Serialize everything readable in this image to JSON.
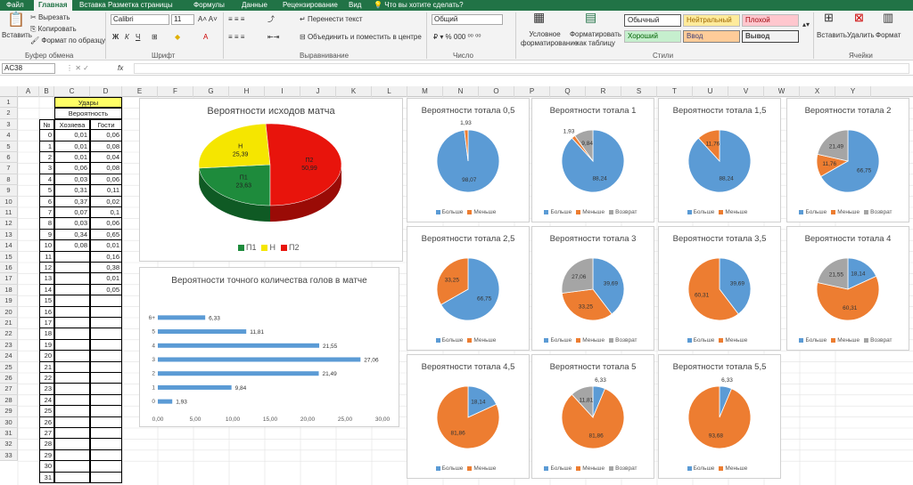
{
  "tabs": [
    "Файл",
    "Главная",
    "Вставка",
    "Разметка страницы",
    "Формулы",
    "Данные",
    "Рецензирование",
    "Вид",
    "Что вы хотите сделать?"
  ],
  "ribbon": {
    "paste": "Вставить",
    "cut": "Вырезать",
    "copy": "Копировать",
    "format_painter": "Формат по образцу",
    "clipboard": "Буфер обмена",
    "font_name": "Calibri",
    "font_size": "11",
    "font": "Шрифт",
    "wrap_text": "Перенести текст",
    "merge": "Объединить и поместить в центре",
    "alignment": "Выравнивание",
    "number_format": "Общий",
    "number": "Число",
    "cond_format": "Условное форматирование",
    "format_table": "Форматировать как таблицу",
    "styles_label": "Стили",
    "style_normal": "Обычный",
    "style_neutral": "Нейтральный",
    "style_bad": "Плохой",
    "style_good": "Хороший",
    "style_input": "Ввод",
    "style_output": "Вывод",
    "insert": "Вставить",
    "delete": "Удалить",
    "format": "Формат",
    "cells": "Ячейки"
  },
  "formula_bar": {
    "name_box": "AC38",
    "fx": "fx",
    "value": ""
  },
  "columns": [
    "A",
    "B",
    "C",
    "D",
    "E",
    "F",
    "G",
    "H",
    "I",
    "J",
    "K",
    "L",
    "M",
    "N",
    "O",
    "P",
    "Q",
    "R",
    "S",
    "T",
    "U",
    "V",
    "W",
    "X",
    "Y"
  ],
  "rows": [
    "1",
    "2",
    "3",
    "4",
    "5",
    "6",
    "7",
    "8",
    "9",
    "10",
    "11",
    "12",
    "13",
    "14",
    "15",
    "16",
    "17",
    "18",
    "19",
    "20",
    "21",
    "22",
    "23",
    "24",
    "25",
    "26",
    "27",
    "28",
    "29",
    "30",
    "31",
    "32",
    "33"
  ],
  "table": {
    "header1": "Удары",
    "header2": "Вероятность",
    "col_no": "№",
    "col_home": "Хозяева",
    "col_away": "Гости",
    "rows": [
      [
        "0",
        "0,01",
        "0,06"
      ],
      [
        "1",
        "0,01",
        "0,08"
      ],
      [
        "2",
        "0,01",
        "0,04"
      ],
      [
        "3",
        "0,06",
        "0,08"
      ],
      [
        "4",
        "0,03",
        "0,06"
      ],
      [
        "5",
        "0,31",
        "0,11"
      ],
      [
        "6",
        "0,37",
        "0,02"
      ],
      [
        "7",
        "0,07",
        "0,1"
      ],
      [
        "8",
        "0,03",
        "0,06"
      ],
      [
        "9",
        "0,34",
        "0,65"
      ],
      [
        "10",
        "0,08",
        "0,01"
      ],
      [
        "11",
        "",
        "0,16"
      ],
      [
        "12",
        "",
        "0,38"
      ],
      [
        "13",
        "",
        "0,01"
      ],
      [
        "14",
        "",
        "0,05"
      ],
      [
        "15",
        "",
        ""
      ],
      [
        "16",
        "",
        ""
      ],
      [
        "17",
        "",
        ""
      ],
      [
        "18",
        "",
        ""
      ],
      [
        "19",
        "",
        ""
      ],
      [
        "20",
        "",
        ""
      ],
      [
        "21",
        "",
        ""
      ],
      [
        "22",
        "",
        ""
      ],
      [
        "23",
        "",
        ""
      ],
      [
        "24",
        "",
        ""
      ],
      [
        "25",
        "",
        ""
      ],
      [
        "26",
        "",
        ""
      ],
      [
        "27",
        "",
        ""
      ],
      [
        "28",
        "",
        ""
      ],
      [
        "29",
        "",
        ""
      ],
      [
        "30",
        "",
        ""
      ],
      [
        "31",
        "",
        ""
      ]
    ]
  },
  "colors": {
    "green": "#1e8b3c",
    "yellow": "#f5e600",
    "red": "#e8140c",
    "blue": "#5b9bd5",
    "orange": "#ed7d31",
    "gray": "#a5a5a5",
    "excel": "#217346"
  },
  "chart_data": [
    {
      "type": "pie",
      "title": "Вероятности исходов матча",
      "labels": [
        "П1",
        "Н",
        "П2"
      ],
      "values": [
        23.63,
        25.39,
        50.99
      ],
      "value_labels": [
        "23,63",
        "25,39",
        "50,99"
      ],
      "legend": [
        "П1",
        "Н",
        "П2"
      ]
    },
    {
      "type": "bar",
      "title": "Вероятности точного количества голов в матче",
      "categories": [
        "0",
        "1",
        "2",
        "3",
        "4",
        "5",
        "6+"
      ],
      "values": [
        1.93,
        9.84,
        21.49,
        27.06,
        21.55,
        11.81,
        6.33
      ],
      "value_labels": [
        "1,93",
        "9,84",
        "21,49",
        "27,06",
        "21,55",
        "11,81",
        "6,33"
      ],
      "xlim": [
        0,
        30
      ],
      "xticks": [
        "0,00",
        "5,00",
        "10,00",
        "15,00",
        "20,00",
        "25,00",
        "30,00"
      ]
    },
    {
      "type": "pie",
      "title": "Вероятности тотала 0,5",
      "series": [
        "Больше",
        "Меньше"
      ],
      "values": [
        98.07,
        1.93
      ],
      "value_labels": [
        "98,07",
        "1,93"
      ]
    },
    {
      "type": "pie",
      "title": "Вероятности тотала 1",
      "series": [
        "Больше",
        "Меньше",
        "Возврат"
      ],
      "values": [
        88.24,
        1.93,
        9.84
      ],
      "value_labels": [
        "88,24",
        "1,93",
        "9,84"
      ]
    },
    {
      "type": "pie",
      "title": "Вероятности тотала 1,5",
      "series": [
        "Больше",
        "Меньше"
      ],
      "values": [
        88.24,
        11.76
      ],
      "value_labels": [
        "88,24",
        "11,76"
      ]
    },
    {
      "type": "pie",
      "title": "Вероятности тотала 2",
      "series": [
        "Больше",
        "Меньше",
        "Возврат"
      ],
      "values": [
        66.75,
        11.76,
        21.49
      ],
      "value_labels": [
        "66,75",
        "11,76",
        "21,49"
      ]
    },
    {
      "type": "pie",
      "title": "Вероятности тотала 2,5",
      "series": [
        "Больше",
        "Меньше"
      ],
      "values": [
        66.75,
        33.25
      ],
      "value_labels": [
        "66,75",
        "33,25"
      ]
    },
    {
      "type": "pie",
      "title": "Вероятности тотала 3",
      "series": [
        "Больше",
        "Меньше",
        "Возврат"
      ],
      "values": [
        39.69,
        33.25,
        27.06
      ],
      "value_labels": [
        "39,69",
        "33,25",
        "27,06"
      ]
    },
    {
      "type": "pie",
      "title": "Вероятности тотала 3,5",
      "series": [
        "Больше",
        "Меньше"
      ],
      "values": [
        39.69,
        60.31
      ],
      "value_labels": [
        "39,69",
        "60,31"
      ]
    },
    {
      "type": "pie",
      "title": "Вероятности тотала 4",
      "series": [
        "Больше",
        "Меньше",
        "Возврат"
      ],
      "values": [
        18.14,
        60.31,
        21.55
      ],
      "value_labels": [
        "18,14",
        "60,31",
        "21,55"
      ]
    },
    {
      "type": "pie",
      "title": "Вероятности тотала 4,5",
      "series": [
        "Больше",
        "Меньше"
      ],
      "values": [
        18.14,
        81.86
      ],
      "value_labels": [
        "18,14",
        "81,86"
      ]
    },
    {
      "type": "pie",
      "title": "Вероятности тотала 5",
      "series": [
        "Больше",
        "Меньше",
        "Возврат"
      ],
      "values": [
        6.33,
        81.86,
        11.81
      ],
      "value_labels": [
        "6,33",
        "81,86",
        "11,81"
      ]
    },
    {
      "type": "pie",
      "title": "Вероятности тотала 5,5",
      "series": [
        "Больше",
        "Меньше"
      ],
      "values": [
        6.33,
        93.68
      ],
      "value_labels": [
        "6,33",
        "93,68"
      ]
    }
  ]
}
